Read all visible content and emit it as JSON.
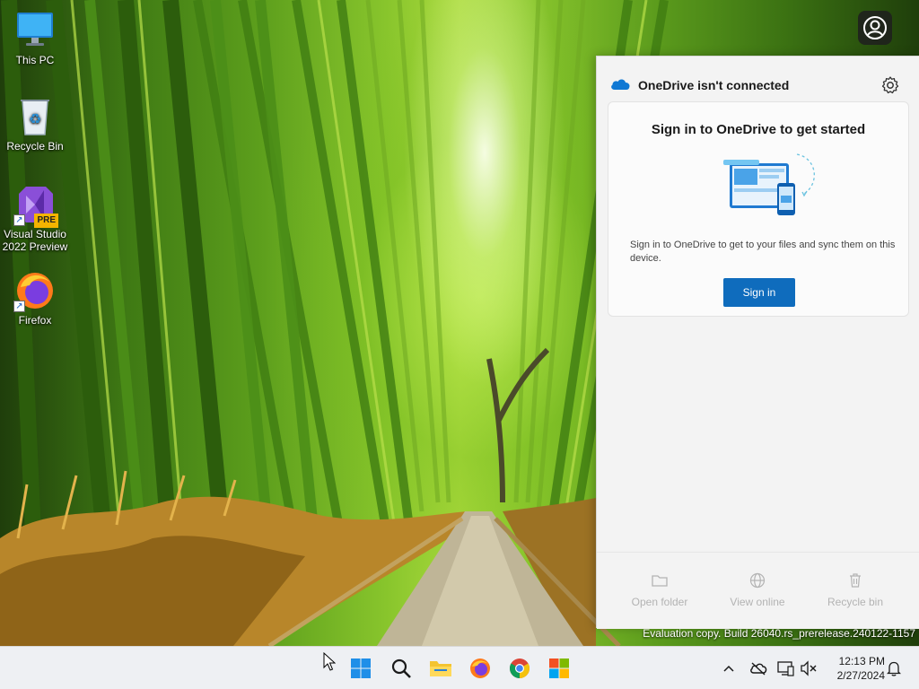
{
  "desktop": {
    "icons": [
      {
        "label": "This PC",
        "icon": "monitor-icon"
      },
      {
        "label": "Recycle Bin",
        "icon": "recycle-bin-icon"
      },
      {
        "label": "Visual Studio 2022 Preview",
        "icon": "visual-studio-icon",
        "badge": "PRE"
      },
      {
        "label": "Firefox",
        "icon": "firefox-icon"
      }
    ]
  },
  "onedrive": {
    "title": "OneDrive isn't connected",
    "card_title": "Sign in to OneDrive to get started",
    "description": "Sign in to OneDrive to get to your files and sync them on this device.",
    "signin_label": "Sign in",
    "actions": [
      {
        "label": "Open folder",
        "icon": "folder-icon"
      },
      {
        "label": "View online",
        "icon": "globe-icon"
      },
      {
        "label": "Recycle bin",
        "icon": "trash-icon"
      }
    ],
    "accent": "#0f6cbd"
  },
  "watermark": "Evaluation copy. Build 26040.rs_prerelease.240122-1157",
  "taskbar": {
    "apps": [
      "start-icon",
      "search-icon",
      "file-explorer-icon",
      "firefox-icon",
      "chrome-icon",
      "microsoft-store-icon"
    ],
    "tray": [
      "chevron-up-icon",
      "onedrive-offline-icon",
      "network-icon",
      "volume-muted-icon",
      "notification-bell-icon"
    ],
    "time": "12:13 PM",
    "date": "2/27/2024"
  }
}
